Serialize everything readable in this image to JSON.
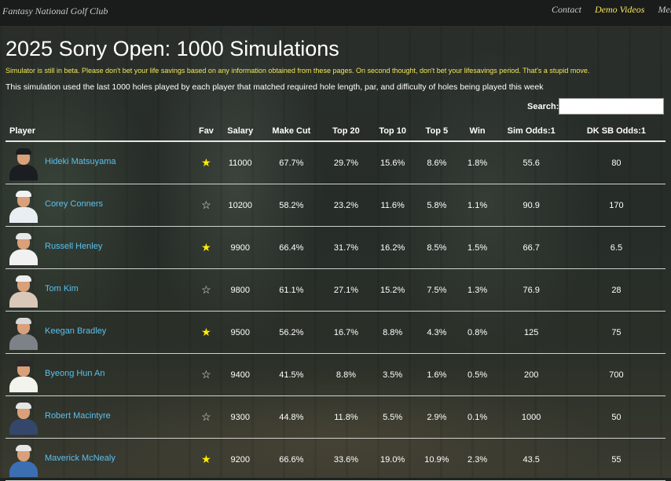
{
  "site": {
    "brand": "Fantasy National Golf Club",
    "nav": [
      {
        "label": "Contact",
        "active": false
      },
      {
        "label": "Demo Videos",
        "active": true
      },
      {
        "label": "Menu",
        "active": false
      }
    ]
  },
  "page": {
    "title": "2025 Sony Open: 1000 Simulations",
    "warning": "Simulator is still in beta. Please don't bet your life savings based on any information obtained from these pages. On second thought, don't bet your lifesavings period. That's a stupid move.",
    "description": "This simulation used the last 1000 holes played by each player that matched required hole length, par, and difficulty of holes being played this week",
    "search": {
      "label": "Search:",
      "value": "",
      "placeholder": ""
    }
  },
  "table": {
    "columns": [
      "Player",
      "Fav",
      "Salary",
      "Make Cut",
      "Top 20",
      "Top 10",
      "Top 5",
      "Win",
      "Sim Odds:1",
      "DK SB Odds:1"
    ],
    "rows": [
      {
        "player": "Hideki Matsuyama",
        "fav": true,
        "star": "★",
        "salary": "11000",
        "make_cut": "67.7%",
        "top20": "29.7%",
        "top10": "15.6%",
        "top5": "8.6%",
        "win": "1.8%",
        "sim_odds": "55.6",
        "dk_odds": "80",
        "shirt": "#1b1d22",
        "cap": "#1b1d22"
      },
      {
        "player": "Corey Conners",
        "fav": false,
        "star": "☆",
        "salary": "10200",
        "make_cut": "58.2%",
        "top20": "23.2%",
        "top10": "11.6%",
        "top5": "5.8%",
        "win": "1.1%",
        "sim_odds": "90.9",
        "dk_odds": "170",
        "shirt": "#e9eef3",
        "cap": "#f2f2f2"
      },
      {
        "player": "Russell Henley",
        "fav": true,
        "star": "★",
        "salary": "9900",
        "make_cut": "66.4%",
        "top20": "31.7%",
        "top10": "16.2%",
        "top5": "8.5%",
        "win": "1.5%",
        "sim_odds": "66.7",
        "dk_odds": "6.5",
        "shirt": "#f1f1f1",
        "cap": "#e8e8e8"
      },
      {
        "player": "Tom Kim",
        "fav": false,
        "star": "☆",
        "salary": "9800",
        "make_cut": "61.1%",
        "top20": "27.1%",
        "top10": "15.2%",
        "top5": "7.5%",
        "win": "1.3%",
        "sim_odds": "76.9",
        "dk_odds": "28",
        "shirt": "#d9c7b8",
        "cap": "#eeeeee"
      },
      {
        "player": "Keegan Bradley",
        "fav": true,
        "star": "★",
        "salary": "9500",
        "make_cut": "56.2%",
        "top20": "16.7%",
        "top10": "8.8%",
        "top5": "4.3%",
        "win": "0.8%",
        "sim_odds": "125",
        "dk_odds": "75",
        "shirt": "#7c8288",
        "cap": "#d8d8d8"
      },
      {
        "player": "Byeong Hun An",
        "fav": false,
        "star": "☆",
        "salary": "9400",
        "make_cut": "41.5%",
        "top20": "8.8%",
        "top10": "3.5%",
        "top5": "1.6%",
        "win": "0.5%",
        "sim_odds": "200",
        "dk_odds": "700",
        "shirt": "#f3f3ee",
        "cap": "#2a2a2a"
      },
      {
        "player": "Robert Macintyre",
        "fav": false,
        "star": "☆",
        "salary": "9300",
        "make_cut": "44.8%",
        "top20": "11.8%",
        "top10": "5.5%",
        "top5": "2.9%",
        "win": "0.1%",
        "sim_odds": "1000",
        "dk_odds": "50",
        "shirt": "#34476b",
        "cap": "#e6e6e6"
      },
      {
        "player": "Maverick McNealy",
        "fav": true,
        "star": "★",
        "salary": "9200",
        "make_cut": "66.6%",
        "top20": "33.6%",
        "top10": "19.0%",
        "top5": "10.9%",
        "win": "2.3%",
        "sim_odds": "43.5",
        "dk_odds": "55",
        "shirt": "#3b6fb2",
        "cap": "#e6e6e6"
      }
    ]
  }
}
